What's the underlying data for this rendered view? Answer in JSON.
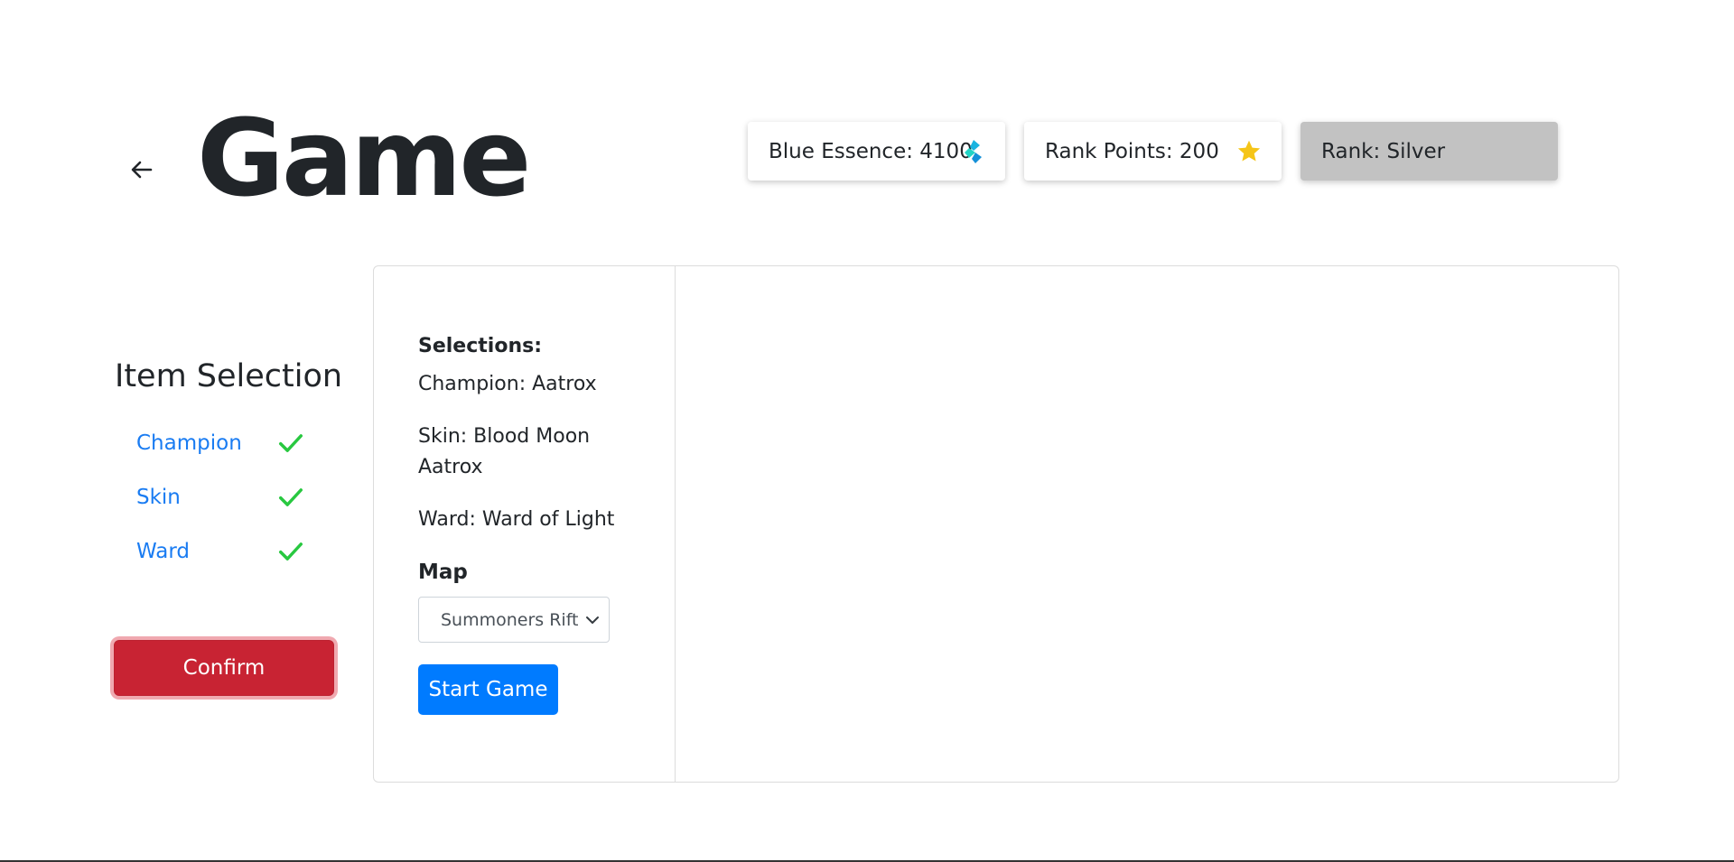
{
  "header": {
    "title": "Game",
    "back_icon": "arrow-left-icon"
  },
  "stats": {
    "blue_essence_label": "Blue Essence: 4100",
    "blue_essence_icon": "blue-essence-icon",
    "rank_points_label": "Rank Points: 200",
    "rank_points_icon": "star-icon",
    "rank_label": "Rank: Silver"
  },
  "sidebar": {
    "title": "Item Selection",
    "items": [
      {
        "label": "Champion",
        "done": true
      },
      {
        "label": "Skin",
        "done": true
      },
      {
        "label": "Ward",
        "done": true
      }
    ],
    "confirm_label": "Confirm"
  },
  "selections": {
    "heading": "Selections:",
    "champion": "Champion: Aatrox",
    "skin": "Skin: Blood Moon Aatrox",
    "ward": "Ward: Ward of Light",
    "map_label": "Map",
    "map_selected": "Summoners Rift",
    "start_label": "Start Game"
  },
  "colors": {
    "link": "#1a7cf2",
    "check": "#28c840",
    "confirm": "#c82333",
    "primary": "#007bff",
    "rank_card": "#c2c2c2",
    "star": "#f5c518",
    "essence": "#1ab4e0"
  }
}
